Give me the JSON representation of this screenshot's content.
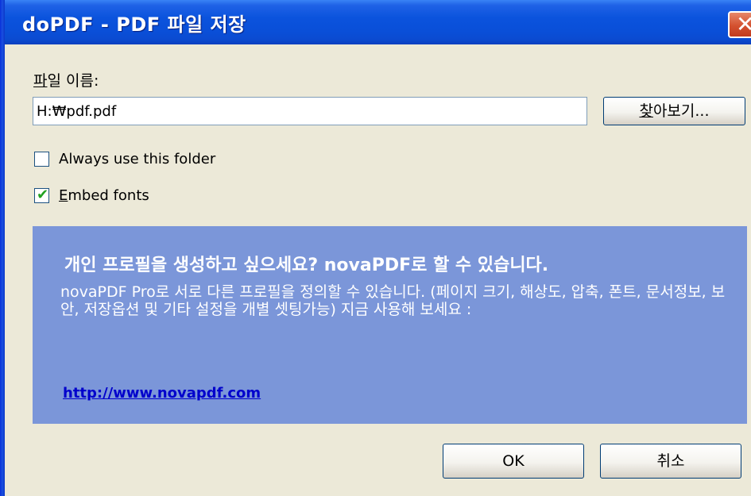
{
  "window": {
    "title": "doPDF - PDF 파일 저장",
    "close_glyph": "✕"
  },
  "filename": {
    "label_accel": "파",
    "label_rest": "일 이름:",
    "value": "H:₩pdf.pdf"
  },
  "browse_button": {
    "accel": "찾",
    "rest": "아보기..."
  },
  "options": {
    "always_use_folder": {
      "label": "Always use this folder",
      "checked": false
    },
    "embed_fonts": {
      "label_accel": "E",
      "label_rest": "mbed fonts",
      "checked": true,
      "check_glyph": "✔"
    }
  },
  "promo": {
    "heading": "개인 프로필을 생성하고 싶으세요? novaPDF로 할 수 있습니다.",
    "body": "novaPDF Pro로 서로 다른 프로필을 정의할 수 있습니다. (페이지 크기, 해상도, 압축, 폰트, 문서정보, 보안, 저장옵션 및 기타 설정을 개별 셋팅가능) 지금 사용해 보세요 :",
    "link": "http://www.novapdf.com"
  },
  "buttons": {
    "ok": "OK",
    "cancel": "취소"
  },
  "colors": {
    "titlebar": "#0b53dd",
    "dialog_bg": "#ece9d8",
    "promo_bg": "#7b96d9",
    "link": "#0000cc",
    "close_button": "#d4512f"
  }
}
